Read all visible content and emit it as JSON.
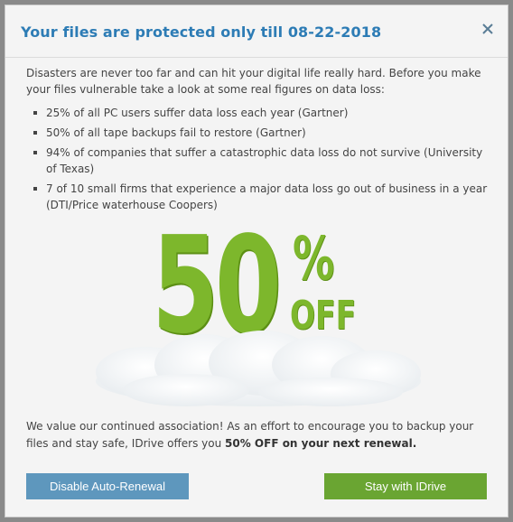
{
  "dialog": {
    "title": "Your files are protected only till 08-22-2018",
    "close_icon": "close-icon",
    "intro": "Disasters are never too far and can hit your digital life really hard. Before you make your files vulnerable take a look at some real figures on data loss:",
    "facts": [
      "25% of all PC users suffer data loss each year (Gartner)",
      "50% of all tape backups fail to restore (Gartner)",
      "94% of companies that suffer a catastrophic data loss do not survive (University of Texas)",
      "7 of 10 small firms that experience a major data loss go out of business in a year (DTI/Price waterhouse Coopers)"
    ],
    "promo": {
      "number": "50",
      "percent": "%",
      "off": "OFF"
    },
    "footer_lead": "We value our continued association! As an effort to encourage you to backup your files and stay safe, IDrive offers you ",
    "footer_bold": "50% OFF on your next renewal.",
    "buttons": {
      "disable_label": "Disable Auto-Renewal",
      "stay_label": "Stay with IDrive"
    }
  },
  "colors": {
    "title": "#2d7cb5",
    "promo_green": "#7db72c",
    "disable_button": "#5e97bd",
    "stay_button": "#6aa532"
  }
}
